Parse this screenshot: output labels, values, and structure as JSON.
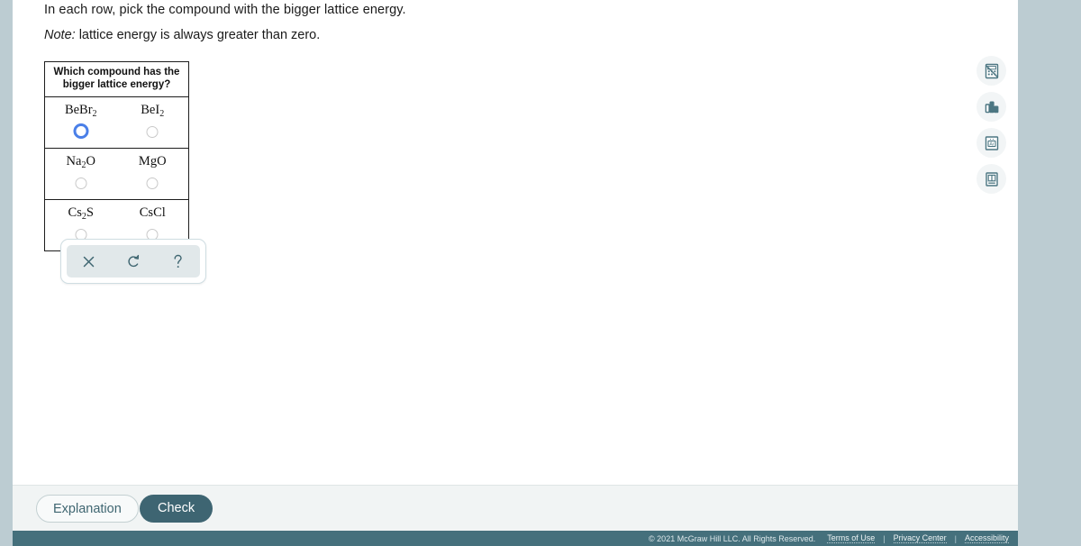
{
  "prompt": {
    "instruction": "In each row, pick the compound with the bigger lattice energy.",
    "note_label": "Note:",
    "note_text": " lattice energy is always greater than zero."
  },
  "table": {
    "header": "Which compound has the bigger lattice energy?",
    "rows": [
      {
        "left": {
          "formula_html": "Be<span class=\"gap\"></span>Br<sub>2</sub>",
          "text": "BeBr2",
          "selected": true
        },
        "right": {
          "formula_html": "Be<span class=\"gap\"></span>I<sub>2</sub>",
          "text": "BeI2",
          "selected": false
        }
      },
      {
        "left": {
          "formula_html": "Na<sub>2</sub><span class=\"gap\"></span>O",
          "text": "Na2O",
          "selected": false
        },
        "right": {
          "formula_html": "Mg<span class=\"gap\"></span>O",
          "text": "MgO",
          "selected": false
        }
      },
      {
        "left": {
          "formula_html": "Cs<sub>2</sub><span class=\"gap\"></span>S",
          "text": "Cs2S",
          "selected": false
        },
        "right": {
          "formula_html": "Cs<span class=\"gap\"></span>Cl",
          "text": "CsCl",
          "selected": false
        }
      }
    ]
  },
  "palette": {
    "clear_label": "×",
    "reset_label": "↺",
    "help_label": "?",
    "items": [
      "clear-icon",
      "undo-icon",
      "help-icon"
    ]
  },
  "tool_rail": {
    "items": [
      {
        "name": "calculator-icon"
      },
      {
        "name": "bar-chart-icon"
      },
      {
        "name": "periodic-table-icon",
        "element_symbol": "Ar"
      },
      {
        "name": "reference-book-icon"
      }
    ]
  },
  "actions": {
    "explanation_label": "Explanation",
    "check_label": "Check"
  },
  "footer": {
    "copyright": "© 2021 McGraw Hill LLC. All Rights Reserved.",
    "links": [
      "Terms of Use",
      "Privacy Center",
      "Accessibility"
    ],
    "separator": "|"
  },
  "colors": {
    "page_background": "#bcccd2",
    "content_background": "#ffffff",
    "action_bar": "#f1f4f4",
    "footer_bar": "#45707c",
    "accent_teal": "#3e6572",
    "selected_radio": "#4a7fe8",
    "palette_panel": "#e1e8ea"
  }
}
